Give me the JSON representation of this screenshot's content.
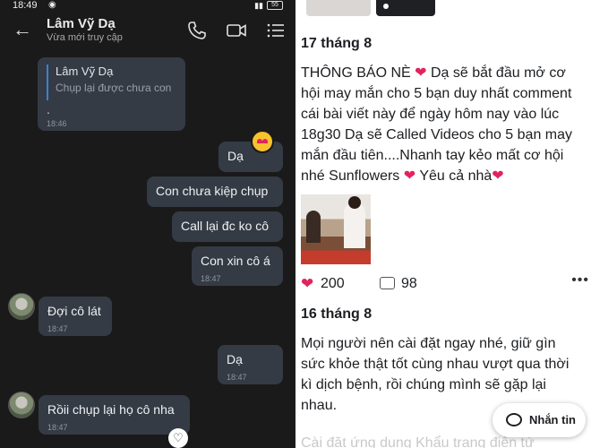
{
  "status_bar": {
    "time": "18:49",
    "battery": "55"
  },
  "chat": {
    "contact_name": "Lâm Vỹ Dạ",
    "contact_status": "Vừa mới truy cập",
    "quoted": {
      "name": "Lâm Vỹ Dạ",
      "text": "Chụp lại được chưa con",
      "extra": ".",
      "time": "18:46"
    },
    "messages": [
      {
        "text": "Dạ",
        "time": "",
        "reaction": "heart-eyes-emoji"
      },
      {
        "text": "Con chưa kiệp chụp",
        "time": ""
      },
      {
        "text": "Call lại đc ko cô",
        "time": ""
      },
      {
        "text": "Con xin cô á",
        "time": "18:47"
      },
      {
        "text": "Đợi cô lát",
        "time": "18:47"
      },
      {
        "text": "Dạ",
        "time": "18:47"
      },
      {
        "text": "Rồii chụp lại họ cô nha",
        "time": "18:47",
        "reaction": "heart"
      }
    ]
  },
  "feed": {
    "post1": {
      "date": "17 tháng 8",
      "lines": [
        "THÔNG BÁO NÈ",
        "Dạ sẽ bắt đầu mở cơ",
        "hội may mắn cho 5 bạn duy nhất comment",
        "cái bài viết này để ngày hôm nay vào lúc",
        "18g30 Dạ sẽ Called Videos cho 5 bạn may",
        "mắn đầu tiên....Nhanh tay kẻo mất cơ hội",
        "nhé Sunflowers",
        "Yêu cả nhà"
      ],
      "likes": "200",
      "comments": "98"
    },
    "post2": {
      "date": "16 tháng 8",
      "lines": [
        "Mọi người nên cài đặt ngay nhé, giữ gìn",
        "sức khỏe thật tốt cùng nhau vượt qua thời",
        "kì dịch bệnh, rồi chúng mình sẽ gặp lại",
        "nhau."
      ],
      "faded": "Cài đặt ứng dụng Khẩu trang điện tử"
    },
    "message_button": "Nhắn tin"
  },
  "colors": {
    "chat_bg": "#1a1a1a",
    "bubble": "#353b45",
    "heart": "#e0245e",
    "quote_bar": "#3d7fd6"
  }
}
